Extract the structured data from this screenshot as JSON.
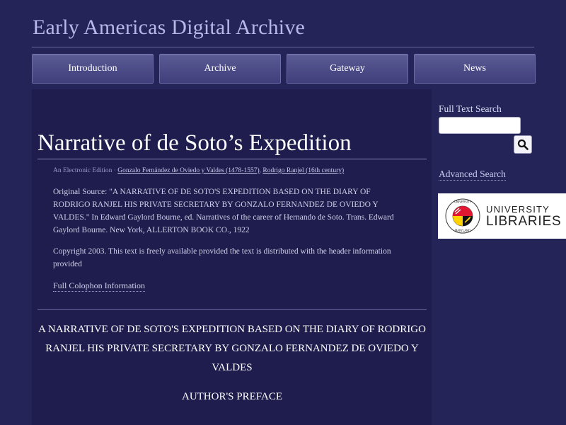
{
  "site": {
    "title": "Early Americas Digital Archive"
  },
  "nav": {
    "items": [
      {
        "label": "Introduction"
      },
      {
        "label": "Archive"
      },
      {
        "label": "Gateway"
      },
      {
        "label": "News"
      }
    ]
  },
  "document": {
    "title": "Narrative of de Soto’s Expedition",
    "byline": {
      "edition": "An Electronic Edition",
      "separator": "·",
      "author1": "Gonzalo Fernández de Oviedo y Valdes (1478-1557)",
      "comma": ",",
      "author2": "Rodrigo Ranjel (16th century)"
    },
    "source": "Original Source: \"A NARRATIVE OF DE SOTO'S EXPEDITION BASED ON THE DIARY OF RODRIGO RANJEL HIS PRIVATE SECRETARY BY GONZALO FERNANDEZ DE OVIEDO Y VALDES.\" In Edward Gaylord Bourne, ed. Narratives of the career of Hernando de Soto. Trans. Edward Gaylord Bourne. New York, ALLERTON BOOK CO., 1922",
    "copyright": "Copyright 2003. This text is freely available provided the text is distributed with the header information provided",
    "colophon_link": "Full Colophon Information",
    "heading": "A NARRATIVE OF DE SOTO'S EXPEDITION BASED ON THE DIARY OF RODRIGO RANJEL HIS PRIVATE SECRETARY BY GONZALO FERNANDEZ DE OVIEDO Y VALDES",
    "preface_heading": "AUTHOR'S PREFACE"
  },
  "sidebar": {
    "search_label": "Full Text Search",
    "search_value": "",
    "search_icon": "magnifier-icon",
    "advanced_search": "Advanced Search",
    "logo": {
      "line1": "UNIVERSITY",
      "line2": "LIBRARIES",
      "seal_text": "UNIVERSITY OF MARYLAND"
    }
  },
  "colors": {
    "background": "#252458",
    "content_panel": "#1e1d4d",
    "nav_button": "#4a4a88",
    "text": "#d8d8ee"
  }
}
